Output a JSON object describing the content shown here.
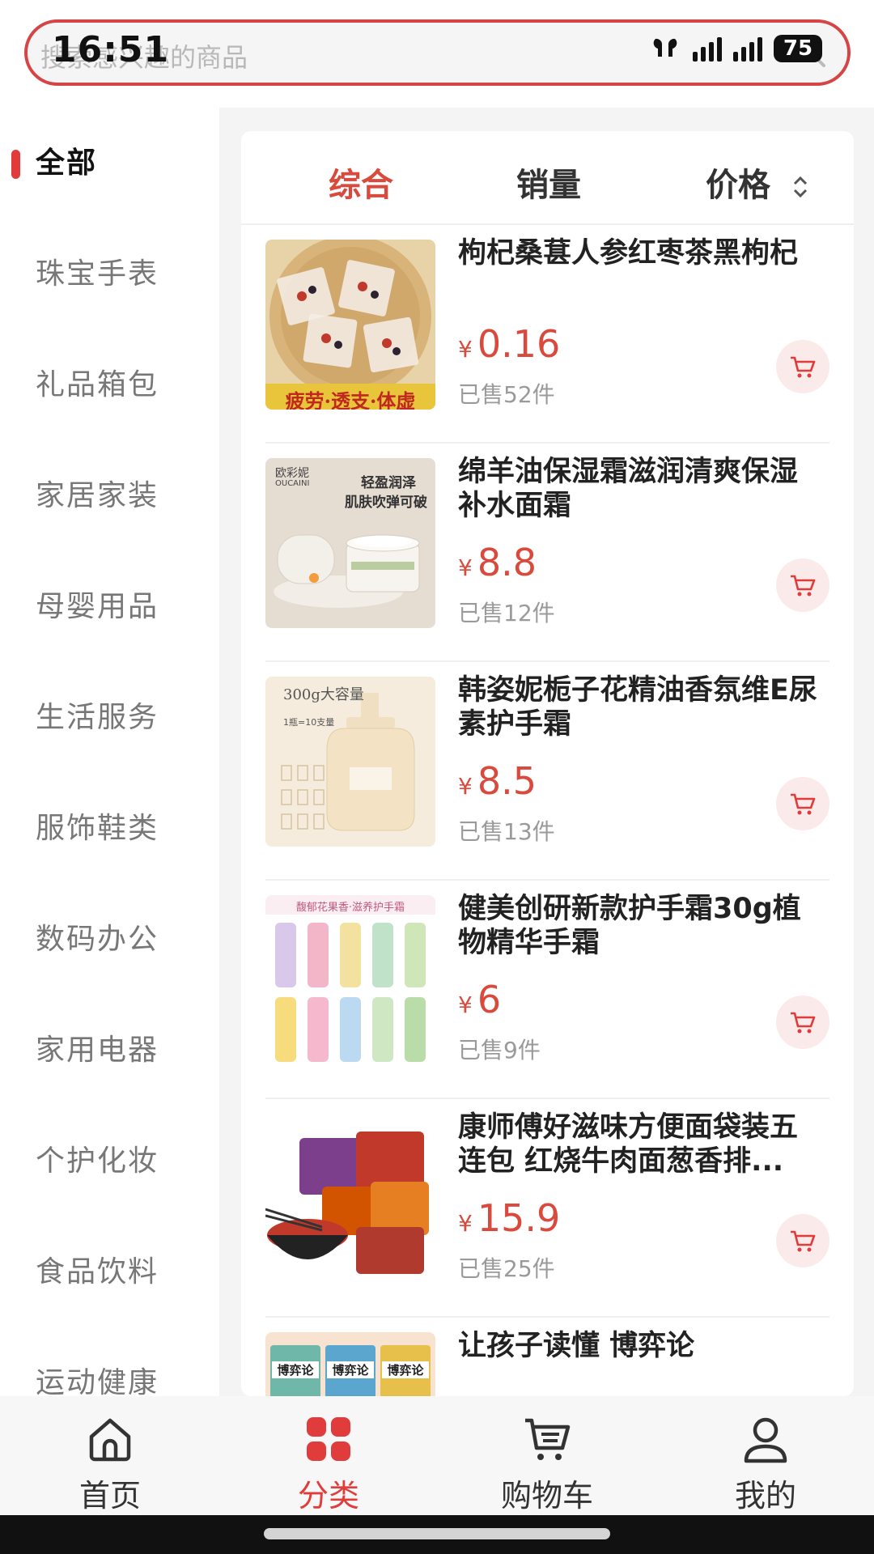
{
  "status_bar": {
    "time": "16:51",
    "battery": "75"
  },
  "search": {
    "placeholder": "搜索感兴趣的商品"
  },
  "sidebar": {
    "items": [
      {
        "label": "全部",
        "active": true
      },
      {
        "label": "珠宝手表"
      },
      {
        "label": "礼品箱包"
      },
      {
        "label": "家居家装"
      },
      {
        "label": "母婴用品"
      },
      {
        "label": "生活服务"
      },
      {
        "label": "服饰鞋类"
      },
      {
        "label": "数码办公"
      },
      {
        "label": "家用电器"
      },
      {
        "label": "个护化妆"
      },
      {
        "label": "食品饮料"
      },
      {
        "label": "运动健康"
      }
    ]
  },
  "sort": {
    "tabs": [
      "综合",
      "销量",
      "价格"
    ],
    "active": "综合"
  },
  "products": [
    {
      "title": "枸杞桑葚人参红枣茶黑枸杞",
      "currency": "¥",
      "price": "0.16",
      "sold": "已售52件",
      "image_caption": "疲劳·透支·体虚"
    },
    {
      "title": "绵羊油保湿霜滋润清爽保湿补水面霜",
      "currency": "¥",
      "price": "8.8",
      "sold": "已售12件",
      "image_brand": "欧彩妮",
      "image_brand_en": "OUCAINI",
      "image_tagline_1": "轻盈润泽",
      "image_tagline_2": "肌肤吹弹可破"
    },
    {
      "title": "韩姿妮栀子花精油香氛维E尿素护手霜",
      "currency": "¥",
      "price": "8.5",
      "sold": "已售13件",
      "image_caption": "300g大容量",
      "image_sub": "1瓶=10支量"
    },
    {
      "title": "健美创研新款护手霜30g植物精华手霜",
      "currency": "¥",
      "price": "6",
      "sold": "已售9件",
      "image_caption": "馥郁花果香·滋养护手霜"
    },
    {
      "title": "康师傅好滋味方便面袋装五连包 红烧牛肉面葱香排...",
      "currency": "¥",
      "price": "15.9",
      "sold": "已售25件"
    },
    {
      "title": "让孩子读懂 博弈论",
      "image_caption": "博弈论"
    }
  ],
  "tabbar": {
    "items": [
      {
        "label": "首页",
        "icon": "home-icon"
      },
      {
        "label": "分类",
        "icon": "category-icon",
        "active": true
      },
      {
        "label": "购物车",
        "icon": "cart-icon"
      },
      {
        "label": "我的",
        "icon": "user-icon"
      }
    ]
  },
  "colors": {
    "accent": "#e03c3c",
    "price": "#d94a3d",
    "search_border": "#d64545"
  }
}
